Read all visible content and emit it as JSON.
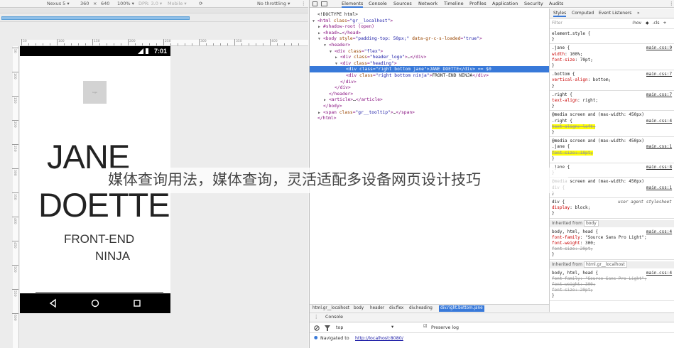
{
  "device_toolbar": {
    "device": "Nexus 5 ▾",
    "width": "360",
    "times": "×",
    "height": "640",
    "zoom": "100% ▾",
    "dpr": "DPR: 3.0 ▾",
    "mode": "Mobile ▾",
    "throttling": "No throttling ▾"
  },
  "ruler": {
    "top_labels": [
      "50",
      "100",
      "150",
      "200",
      "250",
      "300",
      "350",
      "400"
    ],
    "left_labels": [
      "50",
      "100",
      "150",
      "200",
      "250",
      "300",
      "350",
      "400",
      "450",
      "500",
      "550",
      "600"
    ]
  },
  "phone": {
    "status_time": "7:01",
    "logo_alt": "logo",
    "name_line1": "JANE",
    "name_line2": "DOETTE",
    "title_line1": "FRONT-END",
    "title_line2": "NINJA"
  },
  "devtools": {
    "tabs": [
      "Elements",
      "Console",
      "Sources",
      "Network",
      "Timeline",
      "Profiles",
      "Application",
      "Security",
      "Audits"
    ],
    "active_tab": "Elements"
  },
  "dom": [
    {
      "indent": 0,
      "arrow": "",
      "parts": [
        [
          "txt",
          "<!DOCTYPE html>"
        ]
      ]
    },
    {
      "indent": 0,
      "arrow": "▼",
      "parts": [
        [
          "tag",
          "<html "
        ],
        [
          "an",
          "class"
        ],
        [
          "tag",
          "="
        ],
        [
          "av",
          "\"gr__localhost\""
        ],
        [
          "tag",
          ">"
        ]
      ]
    },
    {
      "indent": 1,
      "arrow": "▶",
      "parts": [
        [
          "tag",
          "#shadow-root (open)"
        ]
      ]
    },
    {
      "indent": 1,
      "arrow": "▶",
      "parts": [
        [
          "tag",
          "<head>"
        ],
        [
          "txt",
          "…"
        ],
        [
          "tag",
          "</head>"
        ]
      ]
    },
    {
      "indent": 1,
      "arrow": "▼",
      "parts": [
        [
          "tag",
          "<body "
        ],
        [
          "an",
          "style"
        ],
        [
          "tag",
          "="
        ],
        [
          "av",
          "\"padding-top: 50px;\" "
        ],
        [
          "an",
          "data-gr-c-s-loaded"
        ],
        [
          "tag",
          "="
        ],
        [
          "av",
          "\"true\""
        ],
        [
          "tag",
          ">"
        ]
      ]
    },
    {
      "indent": 2,
      "arrow": "▼",
      "parts": [
        [
          "tag",
          "<header>"
        ]
      ]
    },
    {
      "indent": 3,
      "arrow": "▼",
      "parts": [
        [
          "tag",
          "<div "
        ],
        [
          "an",
          "class"
        ],
        [
          "tag",
          "="
        ],
        [
          "av",
          "\"flex\""
        ],
        [
          "tag",
          ">"
        ]
      ]
    },
    {
      "indent": 4,
      "arrow": "▶",
      "parts": [
        [
          "tag",
          "<div "
        ],
        [
          "an",
          "class"
        ],
        [
          "tag",
          "="
        ],
        [
          "av",
          "\"header_logo\""
        ],
        [
          "tag",
          ">"
        ],
        [
          "txt",
          "…"
        ],
        [
          "tag",
          "</div>"
        ]
      ]
    },
    {
      "indent": 4,
      "arrow": "▼",
      "parts": [
        [
          "tag",
          "<div "
        ],
        [
          "an",
          "class"
        ],
        [
          "tag",
          "="
        ],
        [
          "av",
          "\"heading\""
        ],
        [
          "tag",
          ">"
        ]
      ]
    },
    {
      "indent": 5,
      "arrow": "",
      "sel": true,
      "parts": [
        [
          "tag",
          "<div "
        ],
        [
          "an",
          "class"
        ],
        [
          "tag",
          "="
        ],
        [
          "av",
          "\"right bottom jane\""
        ],
        [
          "tag",
          ">"
        ],
        [
          "txt",
          "JANE DOETTE"
        ],
        [
          "tag",
          "</div>"
        ],
        [
          "txt",
          " == $0"
        ]
      ]
    },
    {
      "indent": 5,
      "arrow": "",
      "parts": [
        [
          "tag",
          "<div "
        ],
        [
          "an",
          "class"
        ],
        [
          "tag",
          "="
        ],
        [
          "av",
          "\"right bottom ninja\""
        ],
        [
          "tag",
          ">"
        ],
        [
          "txt",
          "FRONT-END NINJA"
        ],
        [
          "tag",
          "</div>"
        ]
      ]
    },
    {
      "indent": 4,
      "arrow": "",
      "parts": [
        [
          "tag",
          "</div>"
        ]
      ]
    },
    {
      "indent": 3,
      "arrow": "",
      "parts": [
        [
          "tag",
          "</div>"
        ]
      ]
    },
    {
      "indent": 2,
      "arrow": "",
      "parts": [
        [
          "tag",
          "</header>"
        ]
      ]
    },
    {
      "indent": 2,
      "arrow": "▶",
      "parts": [
        [
          "tag",
          "<article>"
        ],
        [
          "txt",
          "…"
        ],
        [
          "tag",
          "</article>"
        ]
      ]
    },
    {
      "indent": 1,
      "arrow": "",
      "parts": [
        [
          "tag",
          "</body>"
        ]
      ]
    },
    {
      "indent": 1,
      "arrow": "▶",
      "parts": [
        [
          "tag",
          "<span "
        ],
        [
          "an",
          "class"
        ],
        [
          "tag",
          "="
        ],
        [
          "av",
          "\"gr__tooltip\""
        ],
        [
          "tag",
          ">"
        ],
        [
          "txt",
          "…"
        ],
        [
          "tag",
          "</span>"
        ]
      ]
    },
    {
      "indent": 0,
      "arrow": "",
      "parts": [
        [
          "tag",
          "</html>"
        ]
      ]
    }
  ],
  "breadcrumbs": [
    "html.gr__localhost",
    "body",
    "header",
    "div.flex",
    "div.heading",
    "div.right.bottom.jane"
  ],
  "styles_tabs": [
    "Styles",
    "Computed",
    "Event Listeners",
    "»"
  ],
  "styles_filter": {
    "placeholder": "Filter",
    "hov": ":hov",
    "cls": ".cls",
    "add": "+"
  },
  "styles": [
    {
      "text": [
        [
          "val",
          "element.style {"
        ]
      ]
    },
    {
      "text": [
        [
          "val",
          "}"
        ]
      ]
    },
    {
      "text": [
        [
          "val",
          ".jane {"
        ]
      ],
      "src": "main.css:9"
    },
    {
      "text": [
        [
          "val",
          "  "
        ],
        [
          "prop",
          "width"
        ],
        [
          "val",
          ": 100%;"
        ]
      ]
    },
    {
      "text": [
        [
          "val",
          "  "
        ],
        [
          "prop",
          "font-size"
        ],
        [
          "val",
          ": 70pt;"
        ]
      ]
    },
    {
      "text": [
        [
          "val",
          "}"
        ]
      ]
    },
    {
      "text": [
        [
          "val",
          ".bottom {"
        ]
      ],
      "src": "main.css:7"
    },
    {
      "text": [
        [
          "val",
          "  "
        ],
        [
          "prop",
          "vertical-align"
        ],
        [
          "val",
          ": bottom;"
        ]
      ]
    },
    {
      "text": [
        [
          "val",
          "}"
        ]
      ]
    },
    {
      "text": [
        [
          "val",
          ".right {"
        ]
      ],
      "src": "main.css:7"
    },
    {
      "text": [
        [
          "val",
          "  "
        ],
        [
          "prop",
          "text-align"
        ],
        [
          "val",
          ": right;"
        ]
      ]
    },
    {
      "text": [
        [
          "val",
          "}"
        ]
      ]
    },
    {
      "text": [
        [
          "val",
          "@media screen and (max-width: 450px)"
        ]
      ]
    },
    {
      "text": [
        [
          "val",
          ".right {"
        ]
      ],
      "src": "main.css:4"
    },
    {
      "text": [
        [
          "val",
          "  "
        ],
        [
          "strike hl",
          "text-align: left;"
        ]
      ]
    },
    {
      "text": [
        [
          "val",
          "}"
        ]
      ]
    },
    {
      "text": [
        [
          "val",
          "@media screen and (max-width: 450px)"
        ]
      ]
    },
    {
      "text": [
        [
          "val",
          ".jane {"
        ]
      ],
      "src": "main.css:1"
    },
    {
      "text": [
        [
          "val",
          "  "
        ],
        [
          "strike hl",
          "font-size: 18pt;"
        ]
      ]
    },
    {
      "text": [
        [
          "val",
          "}"
        ]
      ]
    },
    {
      "text": [
        [
          "val",
          ".jane {"
        ]
      ],
      "src": "main.css:8"
    },
    {
      "text": [
        [
          "val",
          "}"
        ]
      ]
    },
    {
      "text": [
        [
          "val",
          "@media screen and (max-width: 450px)"
        ]
      ]
    },
    {
      "text": [
        [
          "val",
          "div {"
        ]
      ],
      "src": "main.css:1"
    },
    {
      "text": [
        [
          "val",
          "}"
        ]
      ]
    },
    {
      "text": [
        [
          "val",
          "div {"
        ]
      ],
      "src": "user agent stylesheet"
    },
    {
      "text": [
        [
          "val",
          "  "
        ],
        [
          "prop",
          "display"
        ],
        [
          "val",
          ": block;"
        ]
      ]
    },
    {
      "text": [
        [
          "val",
          "}"
        ]
      ]
    }
  ],
  "inherited1": {
    "label": "Inherited from",
    "chip": "body"
  },
  "inherited_rules1": [
    {
      "text": [
        [
          "val",
          "body, html, head {"
        ]
      ],
      "src": "main.css:4"
    },
    {
      "text": [
        [
          "val",
          "  "
        ],
        [
          "prop",
          "font-family"
        ],
        [
          "val",
          ": \"Source Sans Pro Light\";"
        ]
      ]
    },
    {
      "text": [
        [
          "val",
          "  "
        ],
        [
          "prop",
          "font-weight"
        ],
        [
          "val",
          ": 300;"
        ]
      ]
    },
    {
      "text": [
        [
          "val",
          "  "
        ],
        [
          "strike",
          "font-size: 20pt;"
        ]
      ]
    },
    {
      "text": [
        [
          "val",
          "}"
        ]
      ]
    }
  ],
  "inherited2": {
    "label": "Inherited from",
    "chip": "html.gr__localhost"
  },
  "inherited_rules2": [
    {
      "text": [
        [
          "val",
          "body, html, head {"
        ]
      ],
      "src": "main.css:4"
    },
    {
      "text": [
        [
          "val",
          "  "
        ],
        [
          "strike",
          "font-family: \"Source Sans Pro Light\";"
        ]
      ]
    },
    {
      "text": [
        [
          "val",
          "  "
        ],
        [
          "strike",
          "font-weight: 300;"
        ]
      ]
    },
    {
      "text": [
        [
          "val",
          "  "
        ],
        [
          "strike",
          "font-size: 20pt;"
        ]
      ]
    },
    {
      "text": [
        [
          "val",
          "}"
        ]
      ]
    }
  ],
  "console": {
    "tab_label": "Console",
    "context": "top",
    "preserve_log": "Preserve log",
    "message_prefix": "Navigated to",
    "message_url": "http://localhost:8080/"
  },
  "overlay_text": "媒体查询用法，媒体查询，灵活适配多设备网页设计技巧",
  "colors": {
    "selection": "#3879d9",
    "highlight": "#ffff00",
    "tag": "#881280",
    "attr_name": "#994500",
    "attr_value": "#1a1aa6",
    "css_prop": "#c80000"
  }
}
